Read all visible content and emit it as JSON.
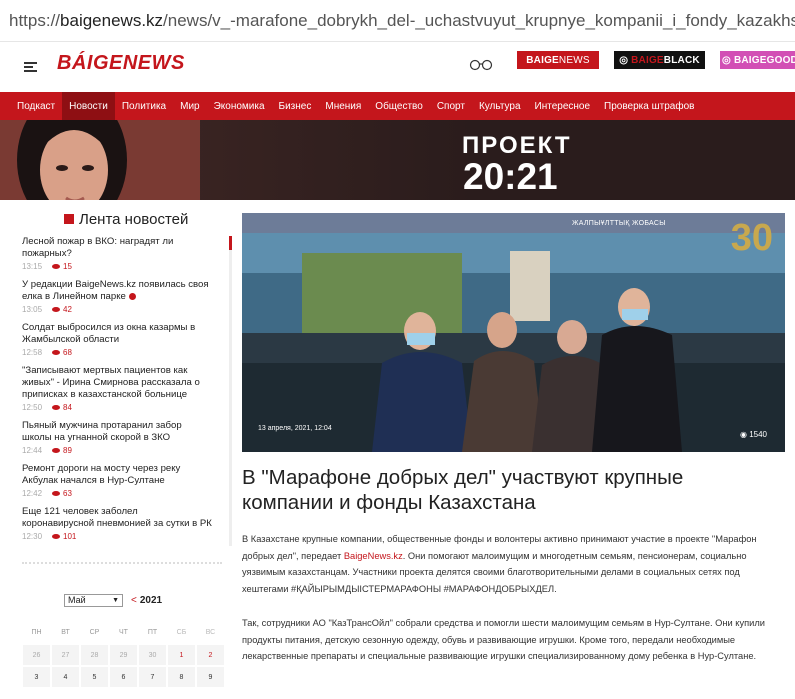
{
  "url": {
    "prefix": "https://",
    "host": "baigenews.kz",
    "path": "/news/v_-marafone_dobrykh_del-_uchastvuyut_krupnye_kompanii_i_fondy_kazakhstana/"
  },
  "header": {
    "logo": "BÁIGENEWS",
    "brands": [
      {
        "prefix": "BAIGE",
        "suffix": "NEWS"
      },
      {
        "prefix": "BAIGE",
        "suffix": "BLACK"
      },
      {
        "prefix": "BAIGE",
        "suffix": "GOOD"
      }
    ]
  },
  "nav": {
    "items": [
      "Подкаст",
      "Новости",
      "Политика",
      "Мир",
      "Экономика",
      "Бизнес",
      "Мнения",
      "Общество",
      "Спорт",
      "Культура",
      "Интересное",
      "Проверка штрафов"
    ],
    "active_index": 1
  },
  "banner": {
    "line1": "ПРОЕКТ",
    "line2": "20:21"
  },
  "sidebar": {
    "title": "Лента новостей",
    "items": [
      {
        "title": "Лесной пожар в ВКО: наградят ли пожарных?",
        "time": "13:15",
        "views": "15"
      },
      {
        "title": "У редакции BaigeNews.kz появилась своя елка в Линейном парке",
        "time": "13:05",
        "views": "42"
      },
      {
        "title": "Солдат выбросился из окна казармы в Жамбылской области",
        "time": "12:58",
        "views": "68"
      },
      {
        "title": "\"Записывают мертвых пациентов как живых\" - Ирина Смирнова рассказала о приписках в казахстанской больнице",
        "time": "12:50",
        "views": "84"
      },
      {
        "title": "Пьяный мужчина протаранил забор школы на угнанной скорой в ЗКО",
        "time": "12:44",
        "views": "89"
      },
      {
        "title": "Ремонт дороги на мосту через реку Акбулак начался в Нур-Султане",
        "time": "12:42",
        "views": "63"
      },
      {
        "title": "Еще 121 человек заболел коронавирусной пневмонией за сутки в РК",
        "time": "12:30",
        "views": "101"
      }
    ]
  },
  "calendar": {
    "month": "Май",
    "prev": "<",
    "year": "2021",
    "weekdays": [
      "ПН",
      "ВТ",
      "СР",
      "ЧТ",
      "ПТ",
      "СБ",
      "ВС"
    ],
    "rows": [
      [
        "26",
        "27",
        "28",
        "29",
        "30",
        "1",
        "2"
      ],
      [
        "3",
        "4",
        "5",
        "6",
        "7",
        "8",
        "9"
      ]
    ]
  },
  "article": {
    "photo_badge": "ЖАЛПЫҰЛТТЫҚ ЖОБАСЫ",
    "photo_anniv": "30",
    "date": "13 апреля, 2021, 12:04",
    "views": "1540",
    "title": "В \"Марафоне добрых дел\" участвуют крупные компании и фонды Казахстана",
    "p1_before": "В Казахстане крупные компании, общественные фонды и волонтеры активно принимают участие в проекте \"Марафон добрых дел\", передает ",
    "p1_link": "BaigeNews.kz",
    "p1_after": ". Они помогают малоимущим и многодетным семьям, пенсионерам, социально уязвимым казахстанцам. Участники проекта делятся своими благотворительными делами в социальных сетях под хештегами #ҚАЙЫРЫМДЫІСТЕРМАРАФОНЫ #МАРАФОНДОБРЫХДЕЛ.",
    "p2": "Так, сотрудники АО \"КазТрансОйл\" собрали средства и помогли шести малоимущим семьям в Нур-Султане. Они купили продукты питания, детскую сезонную одежду, обувь и развивающие игрушки. Кроме того, передали необходимые лекарственные препараты и специальные развивающие игрушки специализированному дому ребенка в Нур-Султане."
  },
  "colors": {
    "accent": "#c4161c",
    "nav_active": "#8e0f13",
    "good": "#d24fb5"
  }
}
